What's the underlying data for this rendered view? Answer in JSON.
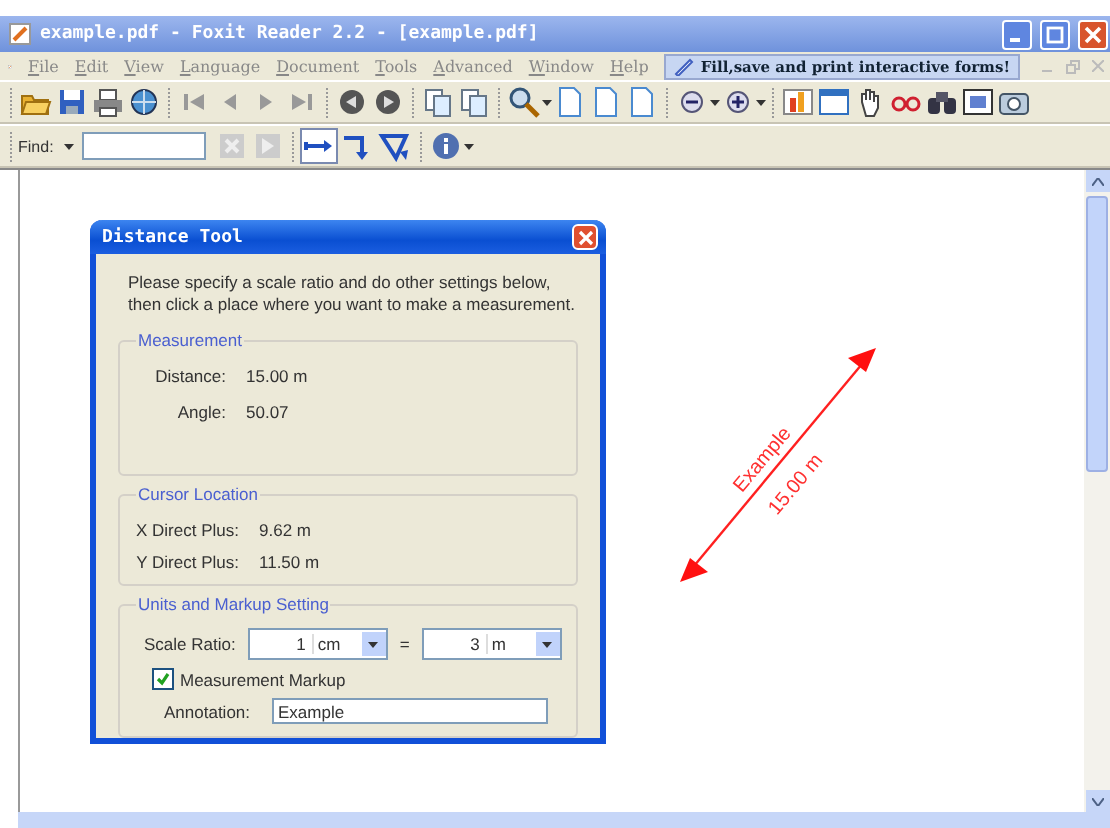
{
  "window": {
    "title": "example.pdf - Foxit Reader 2.2 - [example.pdf]"
  },
  "menu": [
    {
      "label": "File"
    },
    {
      "label": "Edit"
    },
    {
      "label": "View"
    },
    {
      "label": "Language"
    },
    {
      "label": "Document"
    },
    {
      "label": "Tools"
    },
    {
      "label": "Advanced"
    },
    {
      "label": "Window"
    },
    {
      "label": "Help"
    }
  ],
  "promo": "Fill,save and print interactive forms!",
  "find": {
    "label": "Find:"
  },
  "measure_tools": [
    {
      "kind": "distance",
      "selected": true
    },
    {
      "kind": "perimeter",
      "selected": false
    },
    {
      "kind": "area",
      "selected": false
    }
  ],
  "dialog": {
    "title": "Distance Tool",
    "intro": "Please specify a scale ratio and do other settings below, then click a place where you want to make a measurement.",
    "measurement": {
      "title": "Measurement",
      "rows": [
        {
          "label": "Distance:",
          "value": "15.00 m"
        },
        {
          "label": "Angle:",
          "value": "50.07"
        }
      ]
    },
    "cursor": {
      "title": "Cursor Location",
      "rows": [
        {
          "label": "X Direct Plus:",
          "value": "9.62 m"
        },
        {
          "label": "Y Direct Plus:",
          "value": "11.50 m"
        }
      ]
    },
    "units": {
      "title": "Units and Markup Setting",
      "scale_label": "Scale Ratio:",
      "from_value": "1",
      "from_unit": "cm",
      "equals": "=",
      "to_value": "3",
      "to_unit": "m",
      "markup": {
        "label": "Measurement Markup",
        "checked": true
      },
      "annotation": {
        "label": "Annotation:",
        "value": "Example"
      }
    }
  },
  "canvas": {
    "label": "Example",
    "reading": "15.00 m"
  }
}
